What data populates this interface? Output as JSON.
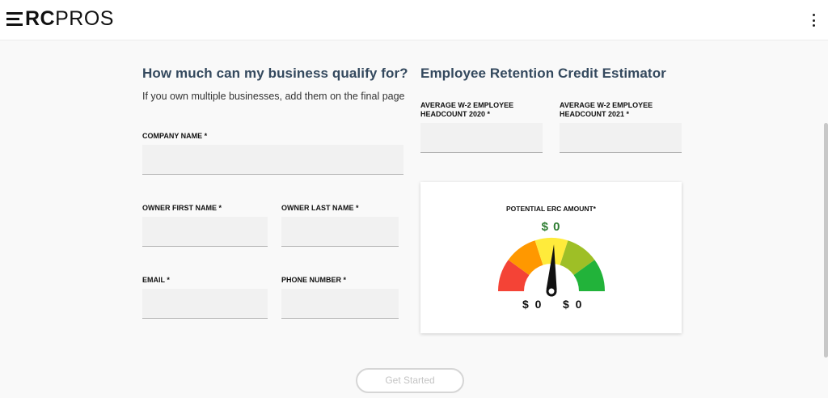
{
  "header": {
    "logo_bold": "RC",
    "logo_light": "PROS",
    "menu_icon": "kebab-menu-icon"
  },
  "form": {
    "title": "How much can my business qualify for?",
    "subtitle": "If you own multiple businesses, add them on the final page",
    "company_label": "COMPANY NAME *",
    "first_name_label": "OWNER FIRST NAME *",
    "last_name_label": "OWNER LAST NAME *",
    "email_label": "EMAIL *",
    "phone_label": "PHONE NUMBER *",
    "company_value": "",
    "first_name_value": "",
    "last_name_value": "",
    "email_value": "",
    "phone_value": ""
  },
  "estimator": {
    "title": "Employee Retention Credit Estimator",
    "headcount_2020_label_line1": "AVERAGE W-2 EMPLOYEE",
    "headcount_2020_label_line2": "HEADCOUNT 2020 *",
    "headcount_2021_label_line1": "AVERAGE W-2 EMPLOYEE",
    "headcount_2021_label_line2": "HEADCOUNT 2021 *",
    "headcount_2020_value": "",
    "headcount_2021_value": "",
    "card_title": "POTENTIAL ERC AMOUNT*",
    "amount": "$ 0",
    "gauge_min": "$ 0",
    "gauge_max": "$ 0",
    "gauge_level": 0.5,
    "gauge_colors": [
      "#f44336",
      "#ff9800",
      "#ffeb3b",
      "#9ebf26",
      "#22b33a"
    ]
  },
  "cta": {
    "label": "Get Started"
  },
  "colors": {
    "heading": "#34495e",
    "amount": "#2e7d32",
    "background": "#f9f9f9"
  }
}
